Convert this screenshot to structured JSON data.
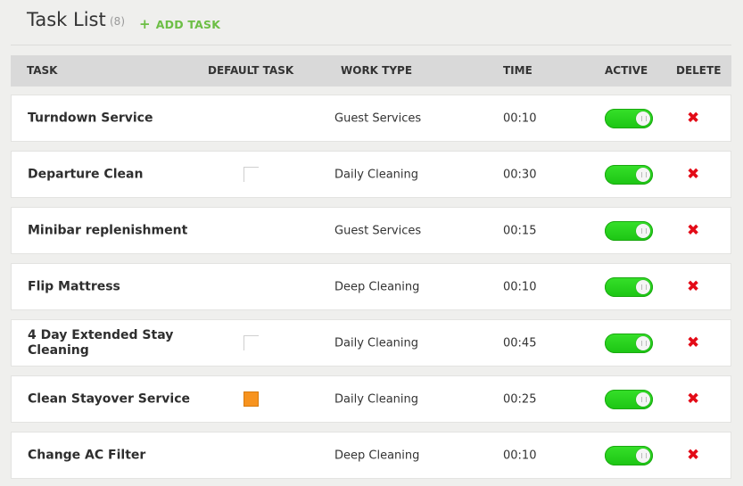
{
  "header": {
    "title": "Task List",
    "count": "(8)",
    "add_plus": "+",
    "add_label": "ADD TASK"
  },
  "table": {
    "columns": [
      "TASK",
      "DEFAULT TASK",
      "WORK TYPE",
      "TIME",
      "ACTIVE",
      "DELETE"
    ],
    "rows": [
      {
        "task": "Turndown Service",
        "default_task": null,
        "work_type": "Guest Services",
        "time": "00:10",
        "active": true
      },
      {
        "task": "Departure Clean",
        "default_task": false,
        "work_type": "Daily Cleaning",
        "time": "00:30",
        "active": true
      },
      {
        "task": "Minibar replenishment",
        "default_task": null,
        "work_type": "Guest Services",
        "time": "00:15",
        "active": true
      },
      {
        "task": "Flip Mattress",
        "default_task": null,
        "work_type": "Deep Cleaning",
        "time": "00:10",
        "active": true
      },
      {
        "task": "4 Day Extended Stay Cleaning",
        "default_task": false,
        "work_type": "Daily Cleaning",
        "time": "00:45",
        "active": true
      },
      {
        "task": "Clean Stayover Service",
        "default_task": true,
        "work_type": "Daily Cleaning",
        "time": "00:25",
        "active": true
      },
      {
        "task": "Change AC Filter",
        "default_task": null,
        "work_type": "Deep Cleaning",
        "time": "00:10",
        "active": true
      }
    ]
  },
  "icons": {
    "add": "plus-icon",
    "delete": "close-x-icon",
    "active": "toggle-switch"
  },
  "colors": {
    "accent_green": "#6cbe45",
    "toggle_green": "#1cc514",
    "delete_red": "#e30b17",
    "checked_orange": "#f7931e"
  },
  "delete_glyph": "✖"
}
